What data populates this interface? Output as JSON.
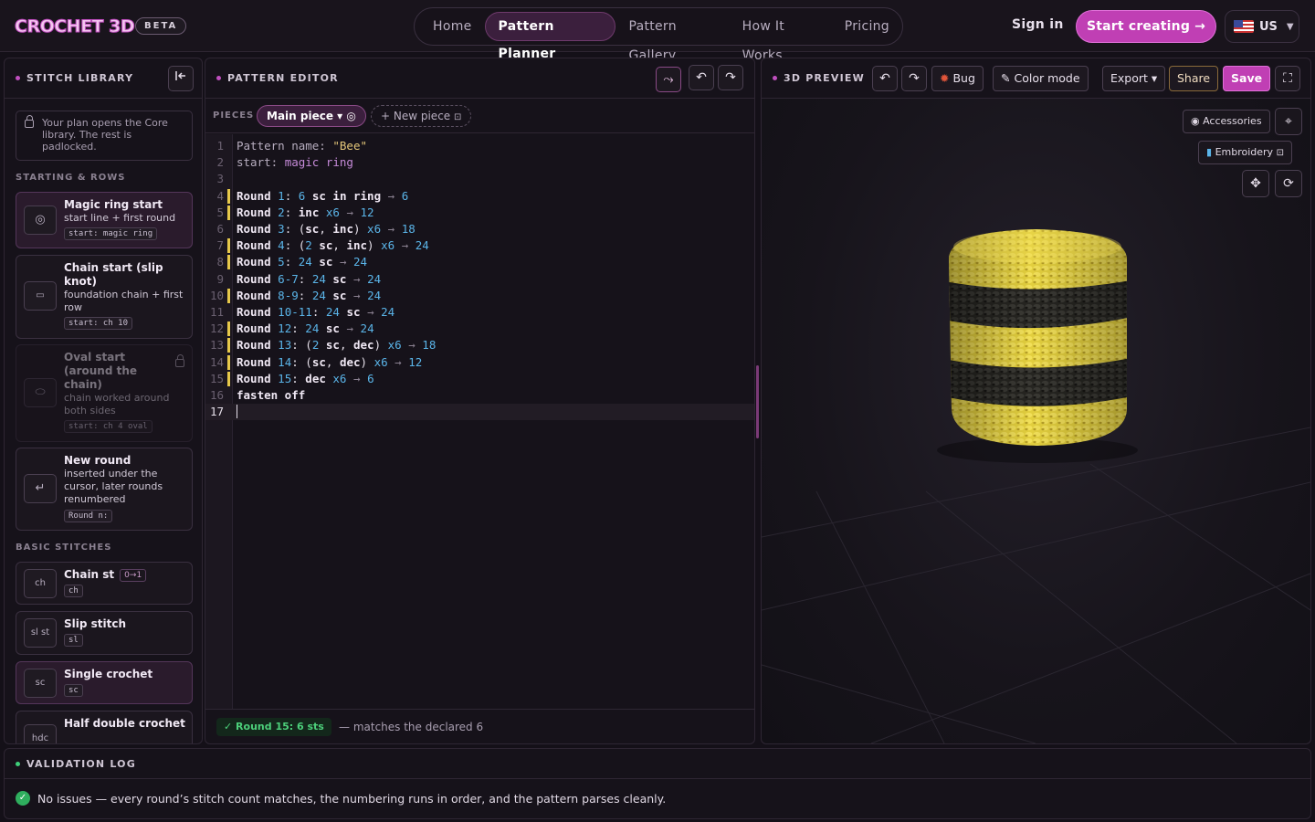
{
  "brand": {
    "logo": "CROCHET 3D",
    "badge": "BETA"
  },
  "nav": {
    "items": [
      "Home",
      "Pattern Planner",
      "Pattern Gallery",
      "How It Works",
      "Pricing"
    ],
    "active": "Pattern Planner"
  },
  "header": {
    "sign_in": "Sign in",
    "cta": "Start creating →",
    "locale": "US"
  },
  "library": {
    "title": "STITCH LIBRARY",
    "note": "Your plan opens the Core library. The rest is padlocked.",
    "sections": {
      "starting": "STARTING & ROWS",
      "basic": "BASIC STITCHES"
    },
    "cards": [
      {
        "title": "Magic ring start",
        "desc": "start line + first round",
        "code": "start: magic ring",
        "icon": "◎"
      },
      {
        "title": "Chain start (slip knot)",
        "desc": "foundation chain + first row",
        "code": "start: ch 10",
        "icon": "▭"
      },
      {
        "title": "Oval start (around the chain)",
        "desc": "chain worked around both sides",
        "code": "start: ch 4 oval",
        "icon": "⬭",
        "locked": true
      },
      {
        "title": "New round",
        "desc": "inserted under the cursor, later rounds renumbered",
        "code": "Round n:",
        "icon": "↵"
      },
      {
        "title": "Chain st",
        "desc": "",
        "code": "ch",
        "icon": "ch",
        "badge": "0→1"
      },
      {
        "title": "Slip stitch",
        "desc": "",
        "code": "sl",
        "icon": "sl st"
      },
      {
        "title": "Single crochet",
        "desc": "",
        "code": "sc",
        "icon": "sc"
      },
      {
        "title": "Half double crochet",
        "desc": "",
        "code": "",
        "icon": "hdc"
      }
    ]
  },
  "editor": {
    "title": "PATTERN EDITOR",
    "pieces_label": "PIECES",
    "active_piece": "Main piece ▾ ◎",
    "new_piece": "+ New piece",
    "lines": [
      "Pattern name: \"Bee\"",
      "start: magic ring",
      "",
      "Round 1: 6 sc in ring → 6",
      "Round 2: inc x6 → 12",
      "Round 3: (sc, inc) x6 → 18",
      "Round 4: (2 sc, inc) x6 → 24",
      "Round 5: 24 sc → 24",
      "Round 6-7: 24 sc → 24",
      "Round 8-9: 24 sc → 24",
      "Round 10-11: 24 sc → 24",
      "Round 12: 24 sc → 24",
      "Round 13: (2 sc, dec) x6 → 18",
      "Round 14: (sc, dec) x6 → 12",
      "Round 15: dec x6 → 6",
      "fasten off",
      ""
    ],
    "status_pill": "✓ Round 15: 6 sts",
    "status_msg": "— matches the declared 6"
  },
  "preview": {
    "title": "3D PREVIEW",
    "bug": "Bug",
    "color_mode": "Color mode",
    "export": "Export ▾",
    "share": "Share",
    "save": "Save",
    "accessories": "◉ Accessories",
    "embroidery": "Embroidery",
    "colors": {
      "yellow": "#e9d648",
      "black": "#2a2926"
    }
  },
  "validation": {
    "title": "VALIDATION LOG",
    "message": "No issues — every round’s stitch count matches, the numbering runs in order, and the pattern parses cleanly."
  }
}
